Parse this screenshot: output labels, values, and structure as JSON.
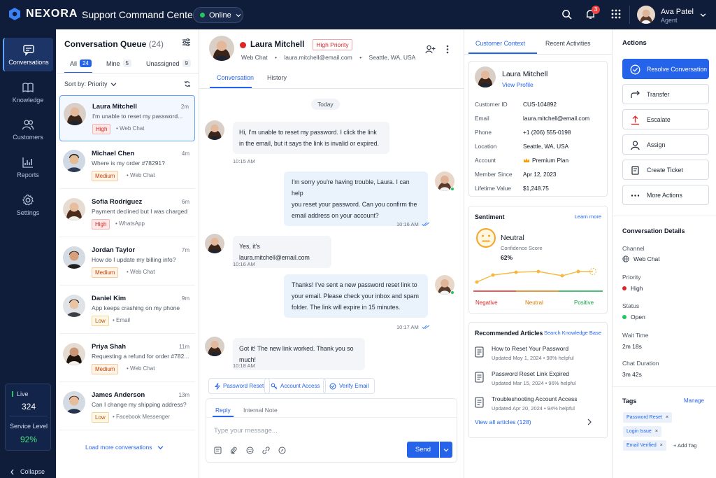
{
  "brand": {
    "name": "NEXORA"
  },
  "app_title": "Support Command Center",
  "status": {
    "label": "Online"
  },
  "notifications": {
    "count": "3"
  },
  "user": {
    "name": "Ava Patel",
    "role": "Agent"
  },
  "nav": [
    {
      "label": "Conversations",
      "icon": "chat-icon"
    },
    {
      "label": "Knowledge",
      "icon": "book-icon"
    },
    {
      "label": "Customers",
      "icon": "users-icon"
    },
    {
      "label": "Reports",
      "icon": "chart-icon"
    },
    {
      "label": "Settings",
      "icon": "gear-icon"
    }
  ],
  "live": {
    "label": "Live",
    "value": "324",
    "service_label": "Service Level",
    "service_value": "92%"
  },
  "collapse_label": "Collapse",
  "queue": {
    "title": "Conversation Queue",
    "count": "(24)",
    "tabs": [
      {
        "label": "All",
        "count": "24"
      },
      {
        "label": "Mine",
        "count": "5"
      },
      {
        "label": "Unassigned",
        "count": "9"
      }
    ],
    "sort_label": "Sort by: Priority",
    "items": [
      {
        "name": "Laura Mitchell",
        "time": "2m",
        "preview": "I'm unable to reset my password...",
        "priority": "High",
        "channel": "Web Chat"
      },
      {
        "name": "Michael Chen",
        "time": "4m",
        "preview": "Where is my order #78291?",
        "priority": "Medium",
        "channel": "Web Chat"
      },
      {
        "name": "Sofia Rodriguez",
        "time": "6m",
        "preview": "Payment declined but I was charged",
        "priority": "High",
        "channel": "WhatsApp"
      },
      {
        "name": "Jordan Taylor",
        "time": "7m",
        "preview": "How do I update my billing info?",
        "priority": "Medium",
        "channel": "Web Chat"
      },
      {
        "name": "Daniel Kim",
        "time": "9m",
        "preview": "App keeps crashing on my phone",
        "priority": "Low",
        "channel": "Email"
      },
      {
        "name": "Priya Shah",
        "time": "11m",
        "preview": "Requesting a refund for order #782...",
        "priority": "Medium",
        "channel": "Web Chat"
      },
      {
        "name": "James Anderson",
        "time": "13m",
        "preview": "Can I change my shipping address?",
        "priority": "Low",
        "channel": "Facebook Messenger"
      }
    ],
    "load_more": "Load more conversations"
  },
  "chat": {
    "name": "Laura Mitchell",
    "priority_badge": "High Priority",
    "channel": "Web Chat",
    "email": "laura.mitchell@email.com",
    "location": "Seattle, WA, USA",
    "tabs": [
      "Conversation",
      "History"
    ],
    "day_label": "Today",
    "messages": [
      {
        "from": "customer",
        "lines": [
          "Hi, I'm unable to reset my password. I click the link",
          "in the email, but it says the link is invalid or expired."
        ],
        "time": "10:15 AM"
      },
      {
        "from": "agent",
        "lines": [
          "I'm sorry you're having trouble, Laura. I can help",
          "you reset your password. Can you confirm the",
          "email address on your account?"
        ],
        "time": "10:16 AM"
      },
      {
        "from": "customer",
        "lines": [
          "Yes, it's laura.mitchell@email.com"
        ],
        "time": "10:16 AM"
      },
      {
        "from": "agent",
        "lines": [
          "Thanks! I've sent a new password reset link to",
          "your email. Please check your inbox and spam",
          "folder. The link will expire in 15 minutes."
        ],
        "time": "10:17 AM"
      },
      {
        "from": "customer",
        "lines": [
          "Got it! The new link worked. Thank you so much!"
        ],
        "time": "10:18 AM"
      }
    ],
    "quick_actions": [
      "Password Reset",
      "Account Access",
      "Verify Email"
    ],
    "composer": {
      "tabs": [
        "Reply",
        "Internal Note"
      ],
      "placeholder": "Type your message...",
      "send_label": "Send"
    }
  },
  "context": {
    "tabs": [
      "Customer Context",
      "Recent Activities"
    ],
    "customer": {
      "name": "Laura Mitchell",
      "link": "View Profile",
      "fields": [
        {
          "k": "Customer ID",
          "v": "CUS-104892"
        },
        {
          "k": "Email",
          "v": "laura.mitchell@email.com"
        },
        {
          "k": "Phone",
          "v": "+1 (206) 555-0198"
        },
        {
          "k": "Location",
          "v": "Seattle, WA, USA"
        },
        {
          "k": "Account",
          "v": "Premium Plan"
        },
        {
          "k": "Member Since",
          "v": "Apr 12, 2023"
        },
        {
          "k": "Lifetime Value",
          "v": "$1,248.75"
        }
      ]
    },
    "sentiment": {
      "title": "Sentiment",
      "link": "Learn more",
      "label": "Neutral",
      "sub": "Confidence Score",
      "value": "62%",
      "axis": [
        "Negative",
        "Neutral",
        "Positive"
      ],
      "colors": {
        "negative": "#dc2626",
        "neutral": "#d97706",
        "positive": "#16a34a"
      }
    },
    "articles": {
      "title": "Recommended Articles",
      "link": "Search Knowledge Base",
      "items": [
        {
          "title": "How to Reset Your Password",
          "meta": "Updated May 1, 2024 • 98% helpful"
        },
        {
          "title": "Password Reset Link Expired",
          "meta": "Updated Mar 15, 2024 • 96% helpful"
        },
        {
          "title": "Troubleshooting Account Access",
          "meta": "Updated Apr 20, 2024 • 94% helpful"
        }
      ],
      "view_all": "View all articles (128)"
    }
  },
  "actions": {
    "title": "Actions",
    "buttons": [
      {
        "label": "Resolve Conversation",
        "icon": "check-circle-icon"
      },
      {
        "label": "Transfer",
        "icon": "transfer-icon"
      },
      {
        "label": "Escalate",
        "icon": "escalate-icon"
      },
      {
        "label": "Assign",
        "icon": "user-icon"
      },
      {
        "label": "Create Ticket",
        "icon": "ticket-icon"
      },
      {
        "label": "More Actions",
        "icon": "dots-icon"
      }
    ],
    "details": {
      "title": "Conversation Details",
      "channel_label": "Channel",
      "channel": "Web Chat",
      "priority_label": "Priority",
      "priority": "High",
      "status_label": "Status",
      "status": "Open",
      "wait_label": "Wait Time",
      "wait": "2m 18s",
      "duration_label": "Chat Duration",
      "duration": "3m 42s"
    },
    "tags": {
      "title": "Tags",
      "manage": "Manage",
      "items": [
        "Password Reset",
        "Login Issue",
        "Email Verified"
      ],
      "add": "+ Add Tag"
    }
  },
  "colors": {
    "accent": "#2563eb",
    "sidebar": "#0f1d3a",
    "high": "#dc2626",
    "open": "#22c55e"
  }
}
